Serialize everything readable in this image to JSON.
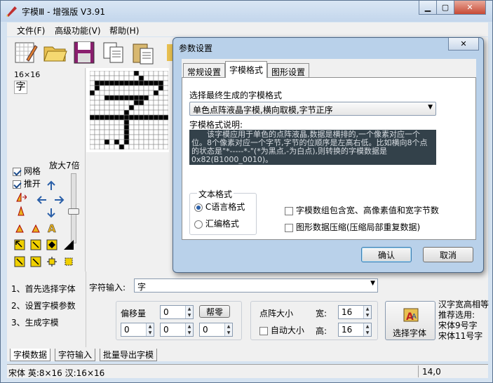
{
  "window": {
    "title": "字模Ⅲ - 增强版 V3.91"
  },
  "menu": [
    "文件(F)",
    "高级功能(V)",
    "帮助(H)"
  ],
  "left_panel": {
    "size_label": "16×16",
    "preview_char": "字",
    "grid_label": "网格",
    "push_label": "推开",
    "zoom_label": "放大7倍"
  },
  "steps": [
    "1、首先选择字体",
    "2、设置字模参数",
    "3、生成字模"
  ],
  "char_input": {
    "label": "字符输入:",
    "value": "字"
  },
  "offset": {
    "label": "偏移量",
    "values": [
      "0",
      "0",
      "0",
      "0"
    ],
    "button": "帮零"
  },
  "matrix": {
    "label": "点阵大小",
    "width_label": "宽:",
    "width": "16",
    "height_label": "高:",
    "height": "16",
    "auto_label": "自动大小"
  },
  "select_font": {
    "label": "选择字体"
  },
  "hint": {
    "lines": [
      "汉字宽高相等",
      "推荐选用:",
      "宋体9号字",
      "宋体11号字"
    ]
  },
  "bottom_tabs": [
    "字模数据",
    "字符输入",
    "批量导出字模"
  ],
  "status": {
    "left": "宋体 英:8×16 汉:16×16",
    "right": "14,0"
  },
  "dialog": {
    "title": "参数设置",
    "tabs": [
      "常规设置",
      "字模格式",
      "图形设置"
    ],
    "format_label": "选择最终生成的字模格式",
    "format_value": "单色点阵液晶字模,横向取模,字节正序",
    "desc_label": "字模格式说明:",
    "desc_text": "该字模应用于单色的点阵液晶,数据是横排的,一个像素对应一个位。8个像素对应一个字节,字节的位顺序是左高右低。比如横向8个点的状态是\"*-----*-\"(*为黑点,-为白点),则转换的字模数据是0x82(B1000_0010)。",
    "text_format_group": "文本格式",
    "radio_c": "C语言格式",
    "radio_asm": "汇编格式",
    "check_size": "字模数组包含宽、高像素值和宽字节数",
    "check_compress": "图形数据压缩(压缩局部重复数据)",
    "ok": "确认",
    "cancel": "取消"
  },
  "colors": {
    "accent": "#2a5fa8",
    "desc_bg": "#33414a",
    "window_frame": "#d5e3f1",
    "dialog_frame": "#b9d1ea"
  },
  "glyph_bitmap": [
    "0000000001000000",
    "0000000000100000",
    "0111111111111110",
    "0100000000000010",
    "1000000000000100",
    "0001111111110000",
    "0000000001100000",
    "0000000010000000",
    "0000000100000000",
    "1111111111111111",
    "0000000100000000",
    "0000000100000000",
    "0000000100000000",
    "0000000100000000",
    "0001010100000000",
    "0000001000000000"
  ]
}
